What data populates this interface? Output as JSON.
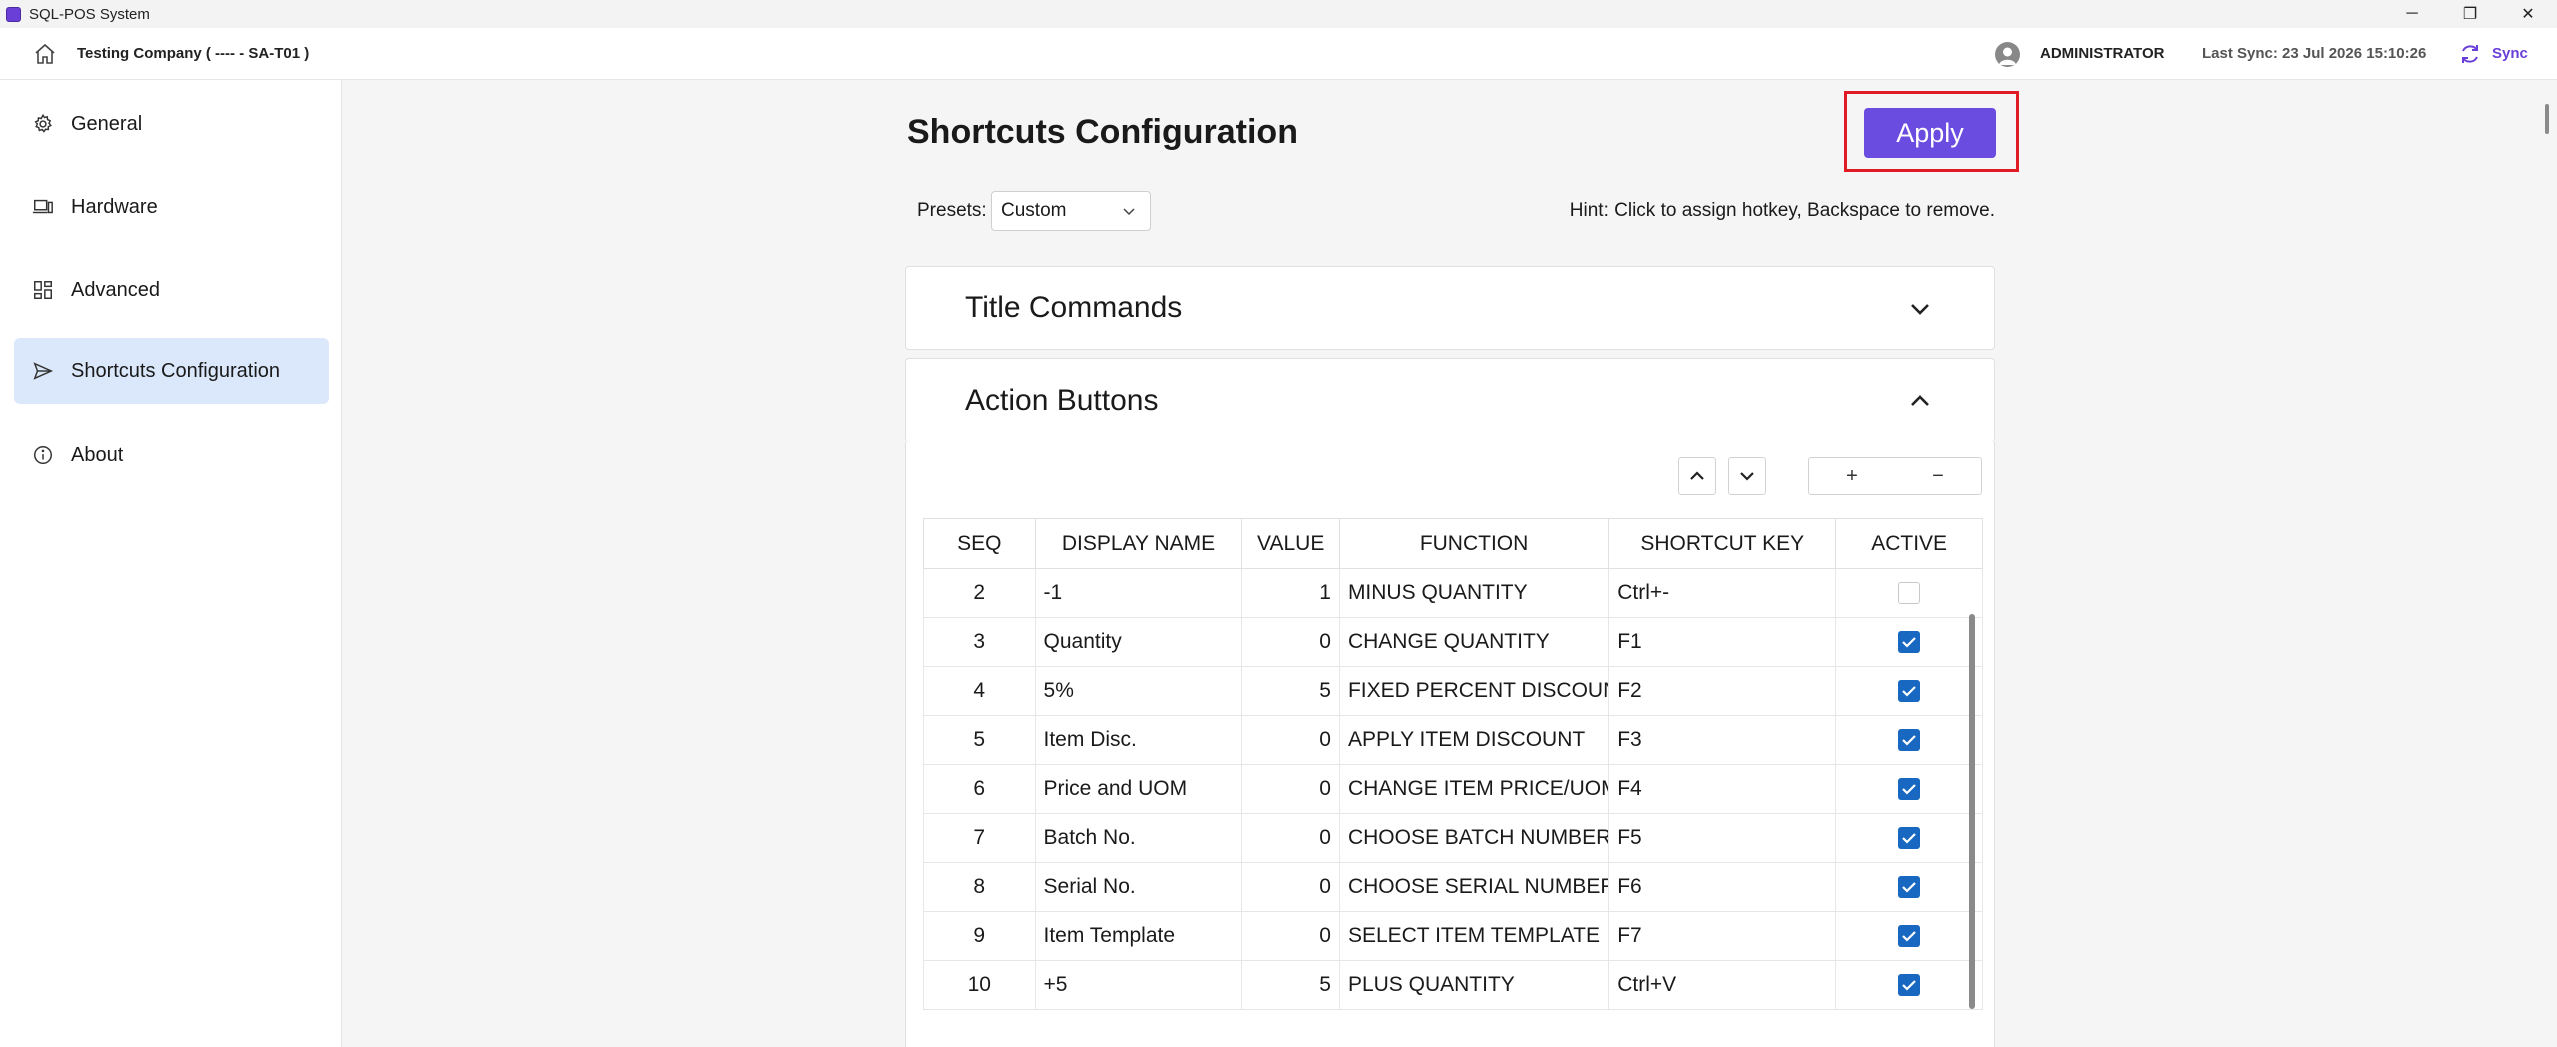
{
  "window": {
    "title": "SQL-POS System",
    "minimize": "─",
    "restore": "❐",
    "close": "✕"
  },
  "header": {
    "company": "Testing Company ( ---- - SA-T01 )",
    "user": "ADMINISTRATOR",
    "last_sync": "Last Sync: 23 Jul 2026 15:10:26",
    "sync_label": "Sync"
  },
  "sidebar": {
    "items": [
      {
        "label": "General",
        "icon": "gear-icon"
      },
      {
        "label": "Hardware",
        "icon": "hardware-icon"
      },
      {
        "label": "Advanced",
        "icon": "grid-icon"
      },
      {
        "label": "Shortcuts Configuration",
        "icon": "send-icon",
        "active": true
      },
      {
        "label": "About",
        "icon": "info-icon"
      }
    ]
  },
  "main": {
    "title": "Shortcuts Configuration",
    "apply_label": "Apply",
    "presets_label": "Presets:",
    "presets_value": "Custom",
    "hint": "Hint: Click to assign hotkey, Backspace to remove.",
    "panels": [
      {
        "title": "Title Commands",
        "expanded": false
      },
      {
        "title": "Action Buttons",
        "expanded": true
      }
    ],
    "plus": "+",
    "minus": "−",
    "table": {
      "headers": [
        "SEQ",
        "DISPLAY NAME",
        "VALUE",
        "FUNCTION",
        "SHORTCUT KEY",
        "ACTIVE"
      ],
      "rows": [
        {
          "seq": "2",
          "name": "-1",
          "value": "1",
          "function": "MINUS QUANTITY",
          "key": "Ctrl+-",
          "active": false
        },
        {
          "seq": "3",
          "name": "Quantity",
          "value": "0",
          "function": "CHANGE QUANTITY",
          "key": "F1",
          "active": true
        },
        {
          "seq": "4",
          "name": "5%",
          "value": "5",
          "function": "FIXED PERCENT DISCOUNT",
          "key": "F2",
          "active": true
        },
        {
          "seq": "5",
          "name": "Item Disc.",
          "value": "0",
          "function": "APPLY ITEM DISCOUNT",
          "key": "F3",
          "active": true
        },
        {
          "seq": "6",
          "name": "Price and UOM",
          "value": "0",
          "function": "CHANGE ITEM PRICE/UOM",
          "key": "F4",
          "active": true
        },
        {
          "seq": "7",
          "name": "Batch No.",
          "value": "0",
          "function": "CHOOSE BATCH NUMBER",
          "key": "F5",
          "active": true
        },
        {
          "seq": "8",
          "name": "Serial No.",
          "value": "0",
          "function": "CHOOSE SERIAL NUMBER",
          "key": "F6",
          "active": true
        },
        {
          "seq": "9",
          "name": "Item Template",
          "value": "0",
          "function": "SELECT ITEM TEMPLATE",
          "key": "F7",
          "active": true
        },
        {
          "seq": "10",
          "name": "+5",
          "value": "5",
          "function": "PLUS QUANTITY",
          "key": "Ctrl+V",
          "active": true
        }
      ]
    }
  },
  "colors": {
    "accent": "#6a4ce0",
    "highlight": "#e01b24",
    "checkbox": "#1867c0",
    "active_nav": "#dbe8fb"
  }
}
